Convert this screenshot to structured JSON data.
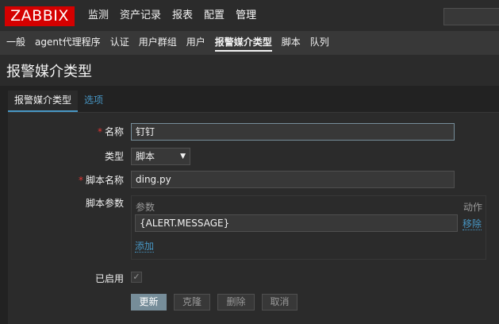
{
  "header": {
    "logo_text": "ZABBIX",
    "main_nav": [
      {
        "label": "监测"
      },
      {
        "label": "资产记录"
      },
      {
        "label": "报表"
      },
      {
        "label": "配置"
      },
      {
        "label": "管理"
      }
    ],
    "sub_nav": [
      {
        "label": "一般"
      },
      {
        "label": "agent代理程序"
      },
      {
        "label": "认证"
      },
      {
        "label": "用户群组"
      },
      {
        "label": "用户"
      },
      {
        "label": "报警媒介类型"
      },
      {
        "label": "脚本"
      },
      {
        "label": "队列"
      }
    ]
  },
  "page": {
    "title": "报警媒介类型",
    "tabs": [
      {
        "label": "报警媒介类型"
      },
      {
        "label": "选项"
      }
    ]
  },
  "form": {
    "name_label": "名称",
    "name_value": "钉钉",
    "type_label": "类型",
    "type_value": "脚本",
    "script_name_label": "脚本名称",
    "script_name_value": "ding.py",
    "script_params_label": "脚本参数",
    "params_header": "参数",
    "action_header": "动作",
    "param_value": "{ALERT.MESSAGE}",
    "remove_link": "移除",
    "add_link": "添加",
    "enabled_label": "已启用",
    "required_mark": "*"
  },
  "buttons": {
    "update": "更新",
    "clone": "克隆",
    "delete": "删除",
    "cancel": "取消"
  },
  "colors": {
    "brand": "#d40000",
    "link": "#4796c4",
    "required": "#e33734",
    "primary_button": "#768d99"
  }
}
